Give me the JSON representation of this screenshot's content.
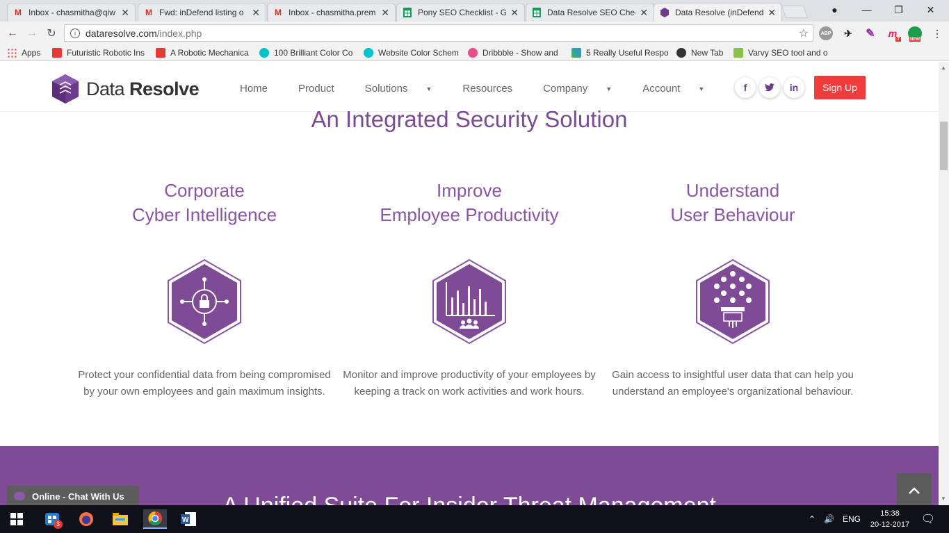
{
  "browser": {
    "tabs": [
      {
        "title": "Inbox - chasmitha@qiw",
        "icon": "gmail-icon",
        "color": "#d93025"
      },
      {
        "title": "Fwd: inDefend listing o",
        "icon": "gmail-icon",
        "color": "#d93025"
      },
      {
        "title": "Inbox - chasmitha.prem",
        "icon": "gmail-icon",
        "color": "#d93025"
      },
      {
        "title": "Pony SEO Checklist - G",
        "icon": "sheets-icon",
        "color": "#0f9d58"
      },
      {
        "title": "Data Resolve SEO Chec",
        "icon": "sheets-icon",
        "color": "#0f9d58"
      },
      {
        "title": "Data Resolve (inDefend",
        "icon": "dataresolve-icon",
        "color": "#6d3a8b"
      }
    ],
    "address": {
      "host": "dataresolve.com",
      "path": "/index.php"
    },
    "bookmarks": [
      {
        "label": "Apps",
        "icon": "apps-grid-icon"
      },
      {
        "label": "Futuristic Robotic Ins",
        "icon": "bookmark-red-icon"
      },
      {
        "label": "A Robotic Mechanica",
        "icon": "bookmark-red-icon"
      },
      {
        "label": "100 Brilliant Color Co",
        "icon": "canva-icon"
      },
      {
        "label": "Website Color Schem",
        "icon": "canva-icon"
      },
      {
        "label": "Dribbble - Show and",
        "icon": "dribbble-icon"
      },
      {
        "label": "5 Really Useful Respo",
        "icon": "tools-icon"
      },
      {
        "label": "New Tab",
        "icon": "newtab-icon"
      },
      {
        "label": "Varvy SEO tool and o",
        "icon": "varvy-icon"
      }
    ],
    "extensions": {
      "abp": "ABP",
      "badge": "7",
      "new": "NEW"
    }
  },
  "site": {
    "logo": {
      "light": "Data ",
      "bold": "Resolve"
    },
    "nav": [
      {
        "label": "Home",
        "dropdown": false
      },
      {
        "label": "Product",
        "dropdown": false
      },
      {
        "label": "Solutions",
        "dropdown": true
      },
      {
        "label": "Resources",
        "dropdown": false
      },
      {
        "label": "Company",
        "dropdown": true
      },
      {
        "label": "Account",
        "dropdown": true
      }
    ],
    "social": {
      "facebook": "f",
      "twitter": "🐦",
      "linkedin": "in"
    },
    "signup": "Sign Up",
    "title": "An Integrated Security Solution",
    "columns": [
      {
        "line1": "Corporate",
        "line2": "Cyber Intelligence",
        "text": "Protect your confidential data from being compromised by your own employees and gain maximum insights.",
        "icon": "lock-network-icon"
      },
      {
        "line1": "Improve",
        "line2": "Employee Productivity",
        "text": "Monitor and improve productivity of your employees by keeping a track on work activities and work hours.",
        "icon": "bar-chart-people-icon"
      },
      {
        "line1": "Understand",
        "line2": "User Behaviour",
        "text": "Gain access to insightful user data that can help you understand an employee's organizational behaviour.",
        "icon": "user-apps-icon"
      }
    ],
    "band_title": "A Unified Suite For Insider Threat Management",
    "chat": "Online - Chat With Us",
    "colors": {
      "accent": "#7f4b97",
      "signup": "#f03c3c"
    }
  },
  "taskbar": {
    "store_badge": "3",
    "lang": "ENG",
    "time": "15:38",
    "date": "20-12-2017"
  }
}
